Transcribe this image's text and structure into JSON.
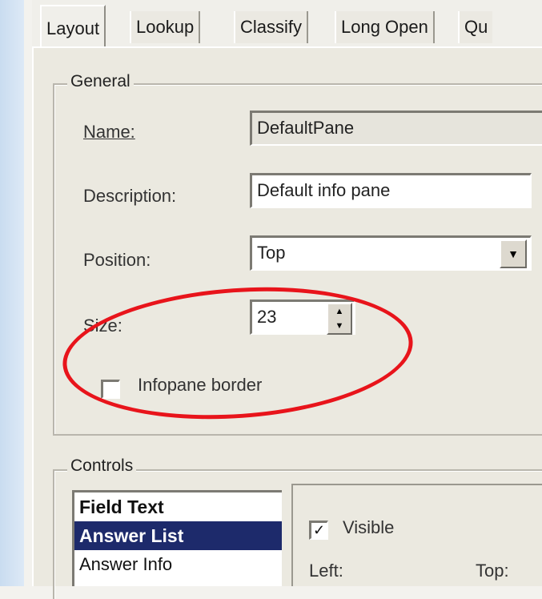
{
  "tabs": [
    "Layout",
    "Lookup",
    "Classify",
    "Long Open",
    "Qu"
  ],
  "general": {
    "legend": "General",
    "name_label": "Name:",
    "name_value": "DefaultPane",
    "description_label": "Description:",
    "description_value": "Default info pane",
    "position_label": "Position:",
    "position_value": "Top",
    "size_label": "Size:",
    "size_value": "23",
    "border_label": "Infopane border",
    "border_checked": false
  },
  "controls": {
    "legend": "Controls",
    "items": [
      "Field Text",
      "Answer List",
      "Answer Info"
    ],
    "selected_index": 1,
    "visible_label": "Visible",
    "visible_checked": true,
    "left_label": "Left:",
    "top_label": "Top:"
  },
  "annotation_color": "#e8141b",
  "selection_color": "#1d2a6b"
}
